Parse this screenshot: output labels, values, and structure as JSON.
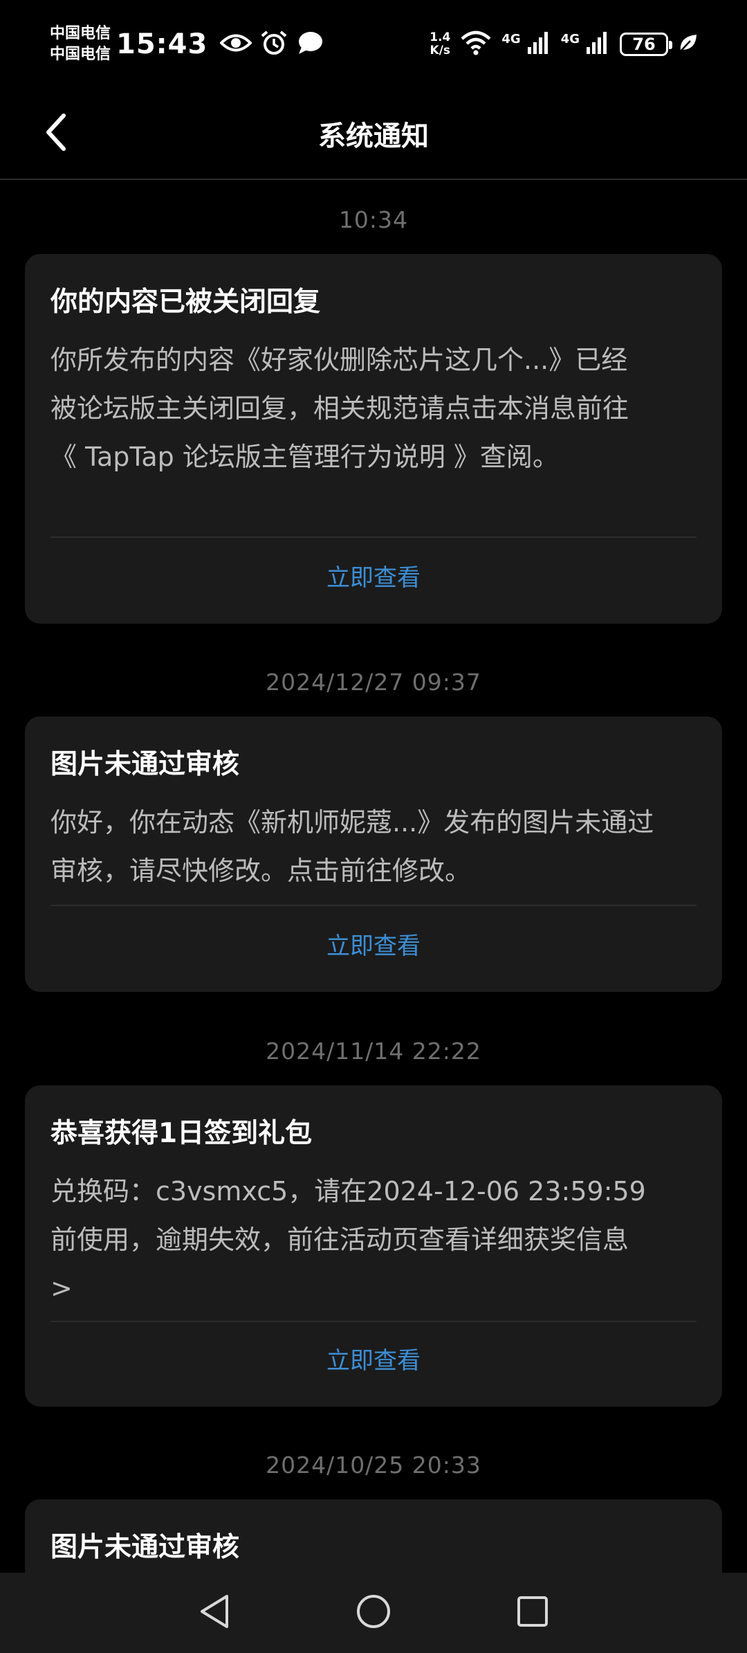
{
  "status_bar": {
    "carrier_1": "中国电信",
    "carrier_2": "中国电信",
    "time": "15:43",
    "net_speed_value": "1.4",
    "net_speed_unit": "K/s",
    "signal_1_label": "4G",
    "signal_2_label": "4G",
    "battery": "76",
    "icons": [
      "eye-icon",
      "alarm-icon",
      "chat-bubble-icon",
      "wifi-icon",
      "signal-icon",
      "battery-icon",
      "leaf-icon"
    ]
  },
  "header": {
    "title": "系统通知",
    "back_icon": "chevron-left-icon"
  },
  "notifications": [
    {
      "time": "10:34",
      "title": "你的内容已被关闭回复",
      "body_lines": [
        "你所发布的内容《好家伙删除芯片这几个...》已经",
        "被论坛版主关闭回复，相关规范请点击本消息前往",
        "《 TapTap 论坛版主管理行为说明 》查阅。"
      ],
      "action": "立即查看"
    },
    {
      "time": "2024/12/27  09:37",
      "title": "图片未通过审核",
      "body_lines": [
        "你好，你在动态《新机师妮蔻...》发布的图片未通过",
        "审核，请尽快修改。点击前往修改。"
      ],
      "action": "立即查看"
    },
    {
      "time": "2024/11/14  22:22",
      "title": "恭喜获得1日签到礼包",
      "body_lines": [
        "兑换码：c3vsmxc5，请在2024-12-06 23:59:59",
        "前使用，逾期失效，前往活动页查看详细获奖信息",
        ">"
      ],
      "action": "立即查看"
    },
    {
      "time": "2024/10/25  20:33",
      "title": "图片未通过审核"
    }
  ],
  "nav_bar": {
    "icons": [
      "back-triangle-icon",
      "home-circle-icon",
      "recents-square-icon"
    ]
  },
  "colors": {
    "background": "#000000",
    "card": "#1b1b1b",
    "accent": "#3d8fd6",
    "timestamp": "#6f6f6f",
    "body_text": "#bcbcbc"
  }
}
